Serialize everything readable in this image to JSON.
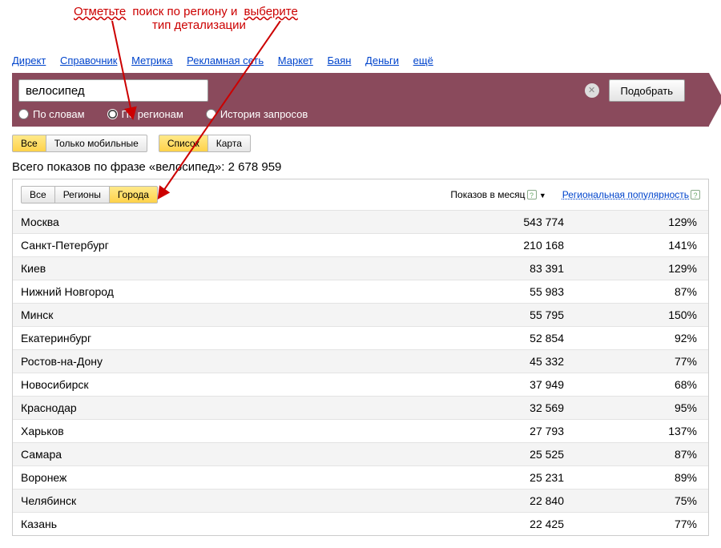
{
  "annotation": {
    "w1": "Отметьте",
    "w2": " поиск по региону и ",
    "w3": "выберите",
    "line2": "тип детализации"
  },
  "nav": {
    "direct": "Директ",
    "sprav": "Справочник",
    "metrika": "Метрика",
    "adnet": "Рекламная сеть",
    "market": "Маркет",
    "bayan": "Баян",
    "money": "Деньги",
    "more": "ещё"
  },
  "search": {
    "value": "велосипед",
    "submit": "Подобрать"
  },
  "radios": {
    "words": "По словам",
    "regions": "По регионам",
    "history": "История запросов"
  },
  "toolbar1": {
    "all": "Все",
    "mobile": "Только мобильные"
  },
  "toolbar2": {
    "list": "Список",
    "map": "Карта"
  },
  "total_prefix": "Всего показов по фразе «",
  "total_suffix": "»: ",
  "total_value": "2 678 959",
  "tabs": {
    "all": "Все",
    "regions": "Регионы",
    "cities": "Города"
  },
  "headers": {
    "shows": "Показов в месяц",
    "pop": "Региональная популярность"
  },
  "rows": [
    {
      "city": "Москва",
      "shows": "543 774",
      "pop": "129%"
    },
    {
      "city": "Санкт-Петербург",
      "shows": "210 168",
      "pop": "141%"
    },
    {
      "city": "Киев",
      "shows": "83 391",
      "pop": "129%"
    },
    {
      "city": "Нижний Новгород",
      "shows": "55 983",
      "pop": "87%"
    },
    {
      "city": "Минск",
      "shows": "55 795",
      "pop": "150%"
    },
    {
      "city": "Екатеринбург",
      "shows": "52 854",
      "pop": "92%"
    },
    {
      "city": "Ростов-на-Дону",
      "shows": "45 332",
      "pop": "77%"
    },
    {
      "city": "Новосибирск",
      "shows": "37 949",
      "pop": "68%"
    },
    {
      "city": "Краснодар",
      "shows": "32 569",
      "pop": "95%"
    },
    {
      "city": "Харьков",
      "shows": "27 793",
      "pop": "137%"
    },
    {
      "city": "Самара",
      "shows": "25 525",
      "pop": "87%"
    },
    {
      "city": "Воронеж",
      "shows": "25 231",
      "pop": "89%"
    },
    {
      "city": "Челябинск",
      "shows": "22 840",
      "pop": "75%"
    },
    {
      "city": "Казань",
      "shows": "22 425",
      "pop": "77%"
    }
  ]
}
